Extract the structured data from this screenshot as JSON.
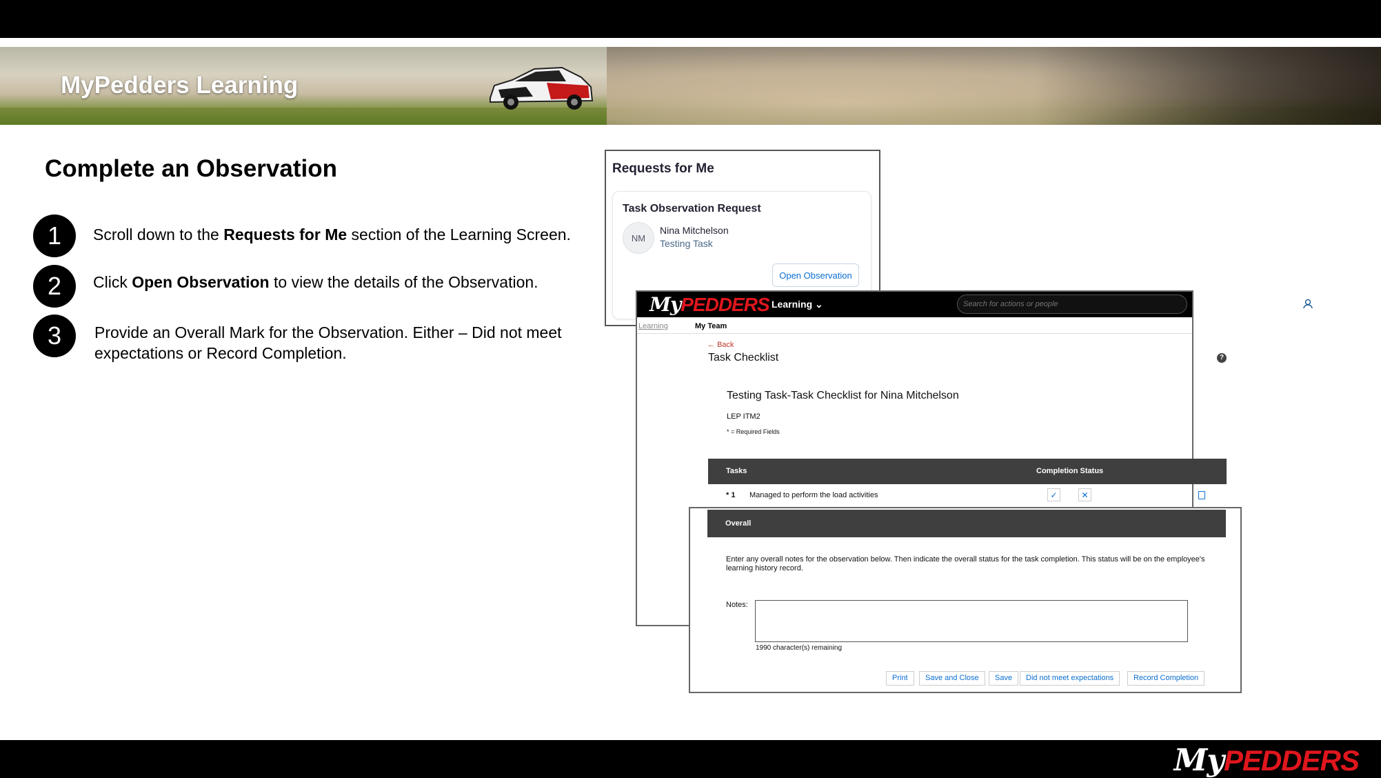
{
  "banner": {
    "title": "MyPedders Learning"
  },
  "slide": {
    "title": "Complete an Observation",
    "steps": [
      {
        "num": "1",
        "pre": "Scroll down to the ",
        "bold": "Requests for Me",
        "post": " section of the Learning Screen."
      },
      {
        "num": "2",
        "pre": "Click ",
        "bold": "Open Observation",
        "post": " to view the details of the Observation."
      },
      {
        "num": "3",
        "pre": "Provide an Overall Mark for the Observation. Either – Did not meet expectations or Record Completion.",
        "bold": "",
        "post": ""
      }
    ]
  },
  "requests": {
    "title": "Requests for Me",
    "card_title": "Task Observation Request",
    "avatar_initials": "NM",
    "name": "Nina Mitchelson",
    "task": "Testing Task",
    "open_button": "Open Observation"
  },
  "app": {
    "logo_my": "My",
    "logo_pedders": "PEDDERS",
    "nav_learning": "Learning",
    "search_placeholder": "Search for actions or people",
    "tab_learning": "Learning",
    "tab_team": "My Team",
    "back": "Back",
    "page_title": "Task Checklist",
    "checklist_title": "Testing Task-Task Checklist for Nina Mitchelson",
    "code": "LEP ITM2",
    "required_note": "* = Required Fields",
    "tasks_header": "Tasks",
    "status_header": "Completion Status",
    "task": {
      "num": "* 1",
      "desc": "Managed to perform the load activities"
    }
  },
  "overall": {
    "header": "Overall",
    "instructions": "Enter any overall notes for the observation below. Then indicate the overall status for the task completion. This status will be on the employee's learning history record.",
    "notes_label": "Notes:",
    "notes_value": "",
    "chars_remaining": "1990  character(s) remaining",
    "buttons": {
      "print": "Print",
      "save_close": "Save and Close",
      "save": "Save",
      "not_met": "Did not meet expectations",
      "record": "Record Completion"
    }
  },
  "footer": {
    "logo_my": "My",
    "logo_pedders": "PEDDERS"
  },
  "colors": {
    "brand_red": "#e0161d",
    "link_blue": "#0a6ed1",
    "header_gray": "#3f3f3f"
  }
}
